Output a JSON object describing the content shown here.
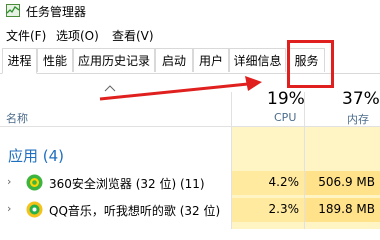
{
  "window": {
    "title": "任务管理器"
  },
  "menu": [
    "文件(F)",
    "选项(O)",
    "查看(V)"
  ],
  "tabs": [
    "进程",
    "性能",
    "应用历史记录",
    "启动",
    "用户",
    "详细信息",
    "服务"
  ],
  "columns": {
    "name": "名称",
    "cpu": {
      "percent": "19%",
      "label": "CPU"
    },
    "memory": {
      "percent": "37%",
      "label": "内存"
    }
  },
  "group": {
    "title": "应用 (4)"
  },
  "rows": [
    {
      "name": "360安全浏览器 (32 位) (11)",
      "cpu": "4.2%",
      "memory": "506.9 MB",
      "icon": "360-browser-icon"
    },
    {
      "name": "QQ音乐，听我想听的歌 (32 位)",
      "cpu": "2.3%",
      "memory": "189.8 MB",
      "icon": "qq-music-icon"
    }
  ],
  "colors": {
    "annotation": "#e0201e",
    "group_title": "#1f6fbf",
    "header_label": "#4d6d8c",
    "highlight": "#ffe28a"
  }
}
